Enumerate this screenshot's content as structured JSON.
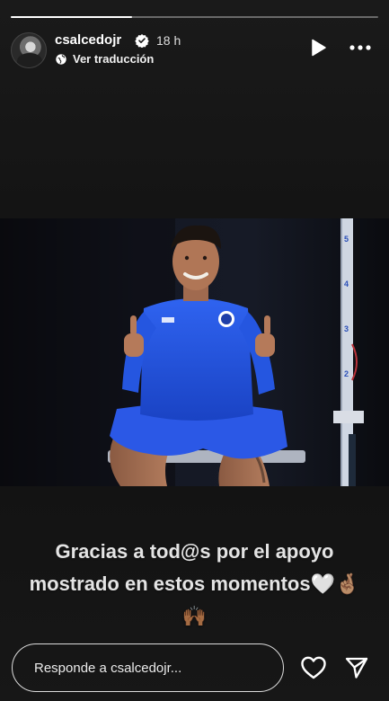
{
  "story": {
    "progress_fraction": 0.33,
    "author": {
      "username": "csalcedojr",
      "verified": true,
      "time_ago": "18 h",
      "avatar_icon": "avatar-icon"
    },
    "translate_label": "Ver traducción",
    "controls": {
      "play_icon": "play-icon",
      "more_icon": "more-options-icon"
    },
    "caption": {
      "text": "Gracias a tod@s por el apoyo mostrado en estos momentos🤍🤞🏽🙌🏾"
    }
  },
  "footer": {
    "reply_placeholder": "Responde a csalcedojr...",
    "like_icon": "heart-icon",
    "send_icon": "send-icon"
  },
  "colors": {
    "background": "#151515",
    "jersey_blue": "#1f4fd6",
    "text": "#ffffff"
  }
}
